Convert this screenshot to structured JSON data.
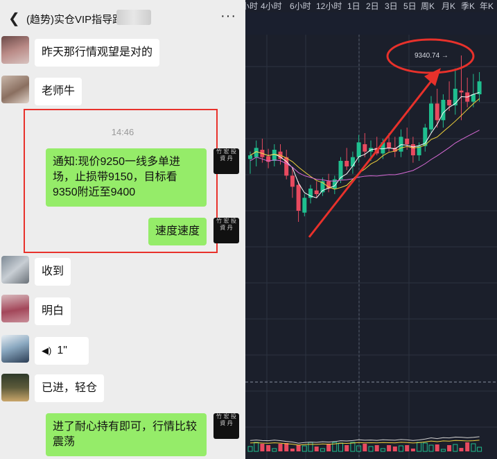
{
  "chat": {
    "back_icon": "chevron-left-icon",
    "title": "(趋势)实仓VIP指导距",
    "more_icon": "more-icon",
    "timestamp": "14:46",
    "messages": [
      {
        "side": "left",
        "text": "昨天那行情观望是对的"
      },
      {
        "side": "left",
        "text": "老师牛"
      },
      {
        "side": "right",
        "text": "通知:现价9250一线多单进场，止损带9150，目标看9350附近至9400"
      },
      {
        "side": "right",
        "text": "速度速度"
      },
      {
        "side": "left",
        "text": "收到"
      },
      {
        "side": "left",
        "text": "明白"
      },
      {
        "side": "left",
        "text": "1\"",
        "icon": "voice-icon"
      },
      {
        "side": "left",
        "text": "已进，轻仓"
      },
      {
        "side": "right",
        "text": "进了耐心持有即可，行情比较震荡"
      }
    ],
    "right_avatar_text": "竹 宏 投 資 丹"
  },
  "chart": {
    "timeframes": [
      "小时",
      "4小时",
      "6小时",
      "12小时",
      "1日",
      "2日",
      "3日",
      "5日",
      "周K",
      "月K",
      "季K",
      "年K"
    ],
    "price_label": "9340.74 →",
    "colors": {
      "up": "#1fbf8f",
      "down": "#e84a5f",
      "ma_fast": "#ffffff",
      "ma_mid": "#f2d33b",
      "ma_slow": "#d86ad6",
      "annotation": "#e8312b",
      "background": "#1b1f2b"
    }
  },
  "chart_data": {
    "type": "candlestick",
    "y_reference": {
      "label": "9340.74",
      "value": 9340.74
    },
    "candles": [
      {
        "o": 9228,
        "h": 9236,
        "l": 9212,
        "c": 9232
      },
      {
        "o": 9230,
        "h": 9248,
        "l": 9220,
        "c": 9240
      },
      {
        "o": 9238,
        "h": 9250,
        "l": 9224,
        "c": 9230
      },
      {
        "o": 9231,
        "h": 9239,
        "l": 9218,
        "c": 9225
      },
      {
        "o": 9226,
        "h": 9244,
        "l": 9220,
        "c": 9238
      },
      {
        "o": 9236,
        "h": 9244,
        "l": 9222,
        "c": 9228
      },
      {
        "o": 9230,
        "h": 9238,
        "l": 9206,
        "c": 9210
      },
      {
        "o": 9210,
        "h": 9218,
        "l": 9186,
        "c": 9198
      },
      {
        "o": 9200,
        "h": 9204,
        "l": 9160,
        "c": 9172
      },
      {
        "o": 9170,
        "h": 9190,
        "l": 9166,
        "c": 9186
      },
      {
        "o": 9186,
        "h": 9200,
        "l": 9180,
        "c": 9196
      },
      {
        "o": 9194,
        "h": 9204,
        "l": 9186,
        "c": 9190
      },
      {
        "o": 9192,
        "h": 9208,
        "l": 9188,
        "c": 9204
      },
      {
        "o": 9204,
        "h": 9212,
        "l": 9192,
        "c": 9196
      },
      {
        "o": 9196,
        "h": 9210,
        "l": 9190,
        "c": 9206
      },
      {
        "o": 9206,
        "h": 9230,
        "l": 9202,
        "c": 9226
      },
      {
        "o": 9226,
        "h": 9240,
        "l": 9216,
        "c": 9220
      },
      {
        "o": 9220,
        "h": 9236,
        "l": 9212,
        "c": 9230
      },
      {
        "o": 9230,
        "h": 9254,
        "l": 9224,
        "c": 9246
      },
      {
        "o": 9244,
        "h": 9256,
        "l": 9230,
        "c": 9236
      },
      {
        "o": 9236,
        "h": 9248,
        "l": 9226,
        "c": 9240
      },
      {
        "o": 9240,
        "h": 9252,
        "l": 9232,
        "c": 9234
      },
      {
        "o": 9234,
        "h": 9250,
        "l": 9228,
        "c": 9246
      },
      {
        "o": 9246,
        "h": 9256,
        "l": 9236,
        "c": 9240
      },
      {
        "o": 9240,
        "h": 9252,
        "l": 9230,
        "c": 9236
      },
      {
        "o": 9236,
        "h": 9260,
        "l": 9230,
        "c": 9252
      },
      {
        "o": 9250,
        "h": 9262,
        "l": 9238,
        "c": 9244
      },
      {
        "o": 9244,
        "h": 9252,
        "l": 9224,
        "c": 9232
      },
      {
        "o": 9232,
        "h": 9246,
        "l": 9226,
        "c": 9242
      },
      {
        "o": 9242,
        "h": 9266,
        "l": 9236,
        "c": 9262
      },
      {
        "o": 9260,
        "h": 9296,
        "l": 9256,
        "c": 9288
      },
      {
        "o": 9288,
        "h": 9304,
        "l": 9262,
        "c": 9270
      },
      {
        "o": 9270,
        "h": 9298,
        "l": 9262,
        "c": 9292
      },
      {
        "o": 9292,
        "h": 9312,
        "l": 9280,
        "c": 9286
      },
      {
        "o": 9286,
        "h": 9326,
        "l": 9276,
        "c": 9304
      },
      {
        "o": 9302,
        "h": 9340,
        "l": 9270,
        "c": 9300
      },
      {
        "o": 9300,
        "h": 9316,
        "l": 9284,
        "c": 9290
      },
      {
        "o": 9290,
        "h": 9320,
        "l": 9284,
        "c": 9298
      },
      {
        "o": 9298,
        "h": 9322,
        "l": 9290,
        "c": 9312
      }
    ]
  }
}
